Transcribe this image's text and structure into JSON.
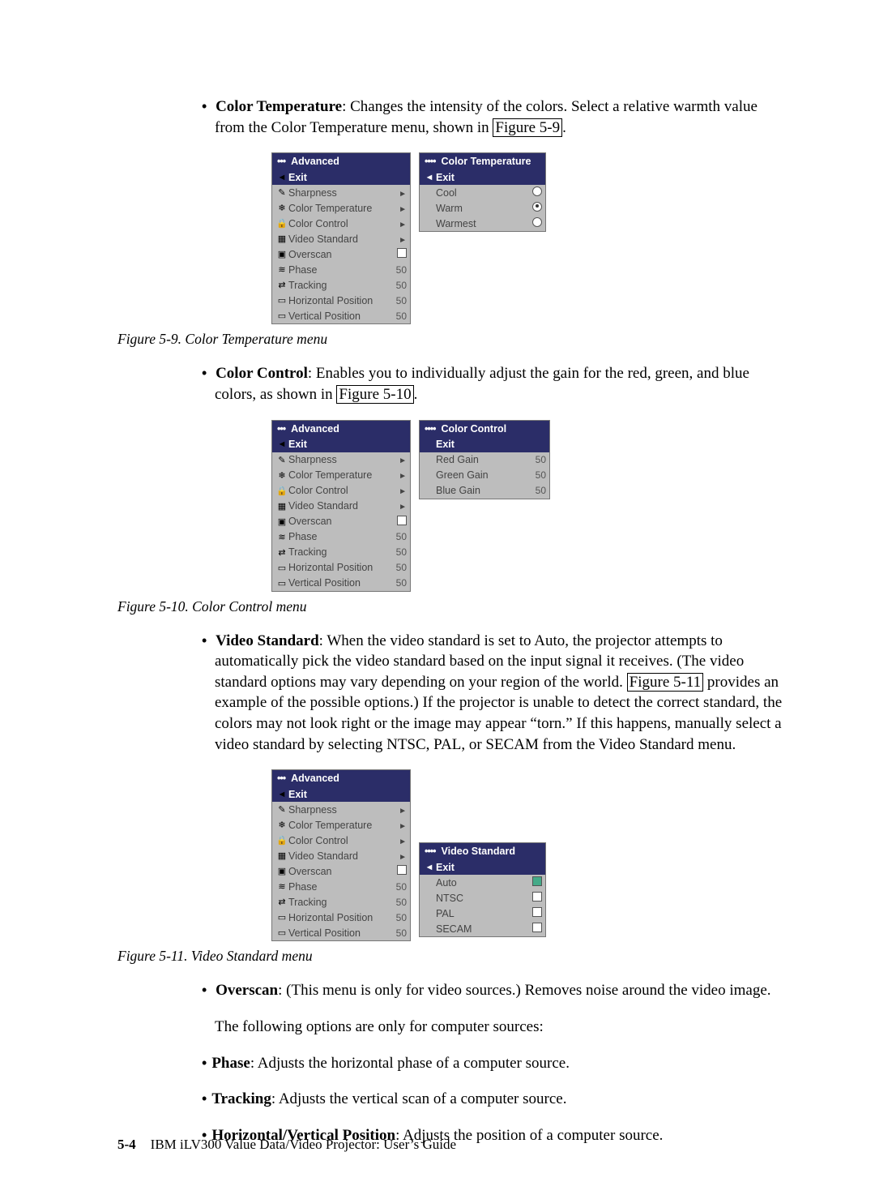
{
  "sections": {
    "color_temp": {
      "term": "Color Temperature",
      "text1": ": Changes the intensity of the colors. Select a relative warmth value from the Color Temperature menu, shown in ",
      "link": "Figure 5-9",
      "text2": "."
    },
    "color_control": {
      "term": "Color Control",
      "text1": ": Enables you to individually adjust the gain for the red, green, and blue colors, as shown in ",
      "link": "Figure 5-10",
      "text2": "."
    },
    "video_standard": {
      "term": "Video Standard",
      "text1": ": When the video standard is set to Auto, the projector attempts to automatically pick the video standard based on the input signal it receives. (The video standard options may vary depending on your region of the world. ",
      "link": "Figure 5-11",
      "text2": " provides an example of the possible options.) If the projector is unable to detect the correct standard, the colors may not look right or the image may appear “torn.” If this happens, manually select a video standard by selecting NTSC, PAL, or SECAM from the Video Standard menu."
    },
    "overscan": {
      "term": "Overscan",
      "text1": ": (This menu is only for video sources.) Removes noise around the video image."
    },
    "note": "The following options are only for computer sources:",
    "phase": {
      "term": "Phase",
      "text1": ": Adjusts the horizontal phase of a computer source."
    },
    "tracking": {
      "term": "Tracking",
      "text1": ": Adjusts the vertical scan of a computer source."
    },
    "hvpos": {
      "term": "Horizontal/Vertical Position",
      "text1": ": Adjusts the position of a computer source."
    }
  },
  "captions": {
    "ct": "Figure 5-9. Color Temperature menu",
    "cc": "Figure 5-10. Color Control menu",
    "vs": "Figure 5-11. Video Standard menu"
  },
  "advanced_panel": {
    "title": "Advanced",
    "rows": [
      {
        "icon": "◄",
        "label": "Exit",
        "val": "",
        "type": "exit"
      },
      {
        "icon": "✎",
        "label": "Sharpness",
        "val": "►"
      },
      {
        "icon": "❄",
        "label": "Color Temperature",
        "val": "►"
      },
      {
        "icon": "🔒",
        "label": "Color Control",
        "val": "►"
      },
      {
        "icon": "▦",
        "label": "Video Standard",
        "val": "►"
      },
      {
        "icon": "▣",
        "label": "Overscan",
        "val": "☐"
      },
      {
        "icon": "≋",
        "label": "Phase",
        "val": "50"
      },
      {
        "icon": "⇄",
        "label": "Tracking",
        "val": "50"
      },
      {
        "icon": "▭",
        "label": "Horizontal Position",
        "val": "50"
      },
      {
        "icon": "▭",
        "label": "Vertical Position",
        "val": "50"
      }
    ]
  },
  "ct_sub": {
    "title": "Color Temperature",
    "rows": [
      {
        "label": "Exit",
        "type": "sel",
        "icon": "◄"
      },
      {
        "label": "Cool",
        "radio": false
      },
      {
        "label": "Warm",
        "radio": true
      },
      {
        "label": "Warmest",
        "radio": false
      }
    ]
  },
  "cc_sub": {
    "title": "Color Control",
    "rows": [
      {
        "label": "Exit",
        "type": "sel",
        "icon": ""
      },
      {
        "label": "Red Gain",
        "val": "50"
      },
      {
        "label": "Green Gain",
        "val": "50"
      },
      {
        "label": "Blue Gain",
        "val": "50"
      }
    ]
  },
  "vs_sub": {
    "title": "Video Standard",
    "rows": [
      {
        "label": "Exit",
        "type": "sel",
        "icon": "◄"
      },
      {
        "label": "Auto",
        "check": true
      },
      {
        "label": "NTSC",
        "check": false
      },
      {
        "label": "PAL",
        "check": false
      },
      {
        "label": "SECAM",
        "check": false
      }
    ]
  },
  "footer": {
    "page": "5-4",
    "bookline": "IBM iLV300 Value Data/Video Projector: User’s Guide"
  }
}
